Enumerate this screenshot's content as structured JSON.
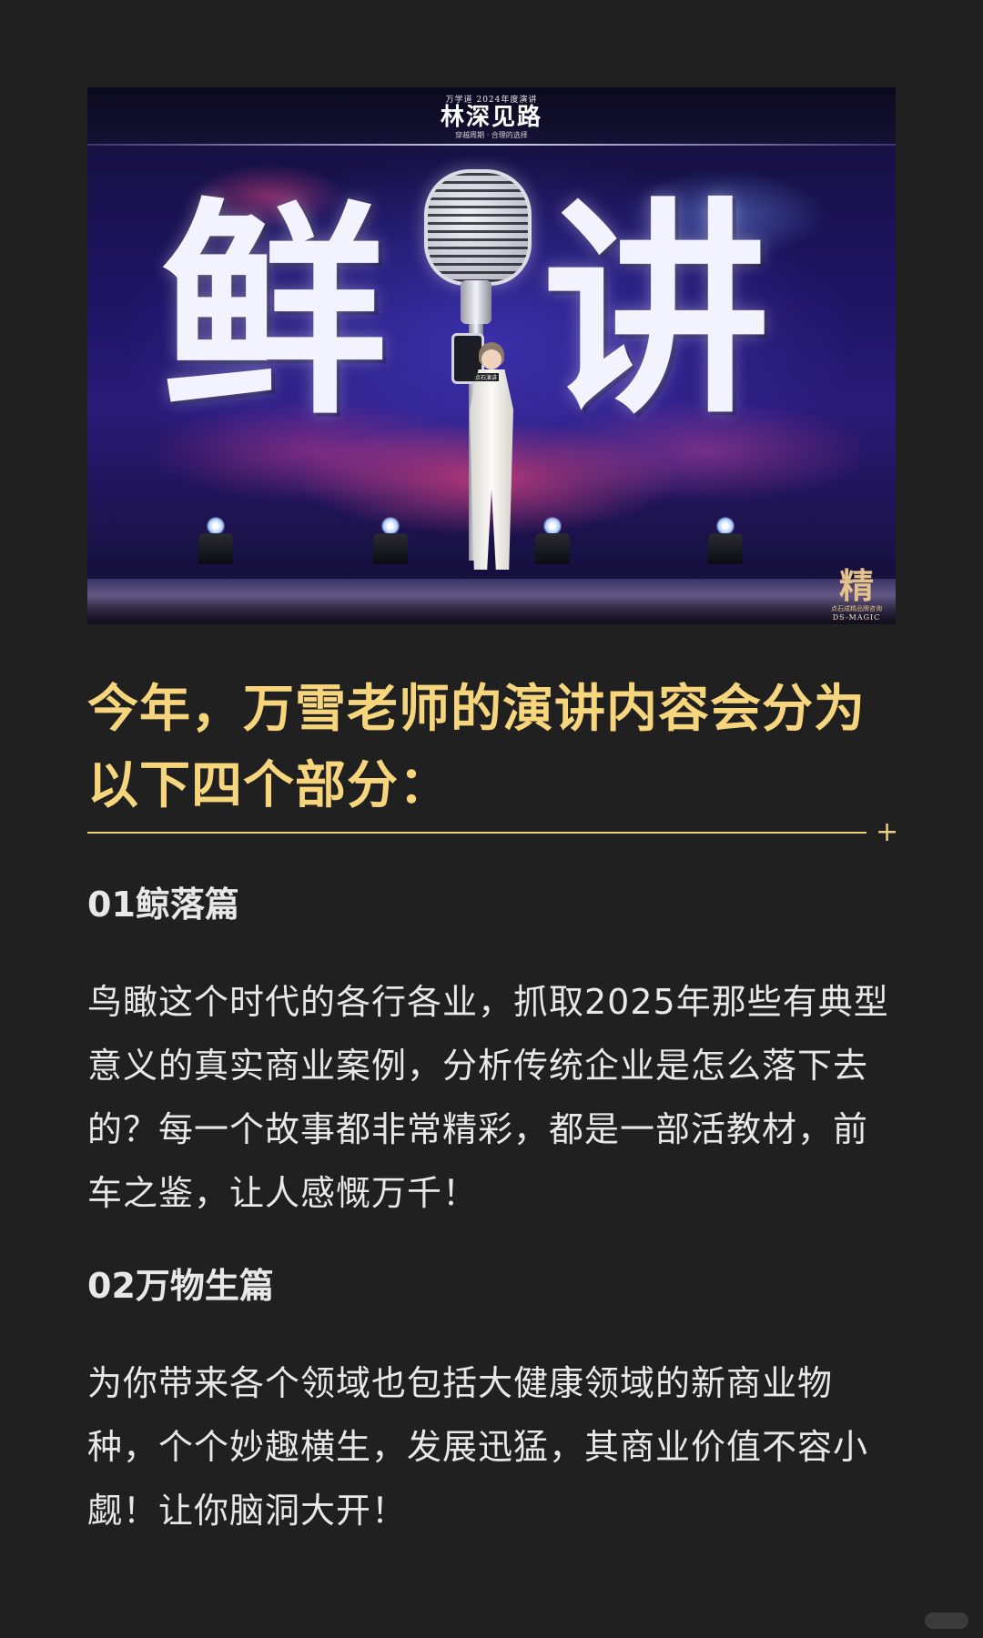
{
  "hero": {
    "banner_small": "万学道 2024年度演讲",
    "banner_title": "林深见路",
    "banner_sub": "穿越周期 · 合理的选择",
    "big_chars": [
      "鲜",
      "讲"
    ],
    "speaker_tag": "点石演讲",
    "corner_logo_glyph": "精",
    "corner_logo_line1": "点石成精品牌咨询",
    "corner_logo_line2": "DS-MAGIC"
  },
  "heading": "今年，万雪老师的演讲内容会分为以下四个部分：",
  "sections": [
    {
      "title": "01鲸落篇",
      "body": "鸟瞰这个时代的各行各业，抓取2025年那些有典型意义的真实商业案例，分析传统企业是怎么落下去的？每一个故事都非常精彩，都是一部活教材，前车之鉴，让人感慨万千！"
    },
    {
      "title": "02万物生篇",
      "body": "为你带来各个领域也包括大健康领域的新商业物种，个个妙趣横生，发展迅猛，其商业价值不容小觑！让你脑洞大开！"
    }
  ],
  "divider_symbol": "+",
  "colors": {
    "background": "#202020",
    "heading": "#f7d57c",
    "divider": "#ecd07f",
    "body_text": "#e8e8e8"
  }
}
